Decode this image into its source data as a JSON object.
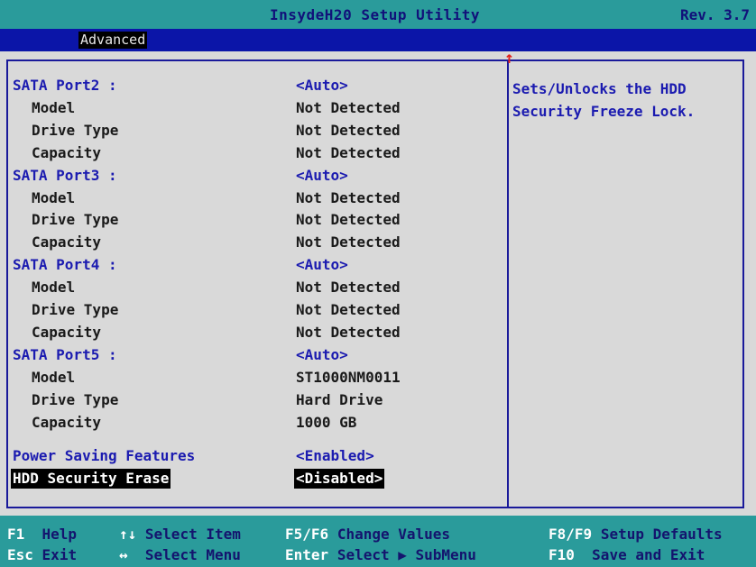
{
  "titlebar": {
    "title": "InsydeH20 Setup Utility",
    "revision": "Rev. 3.7"
  },
  "menu": {
    "active_tab": "Advanced"
  },
  "items": [
    {
      "label": "SATA Port2 :",
      "value": "<Auto>",
      "kind": "header"
    },
    {
      "label": "Model",
      "value": "Not Detected",
      "kind": "sub"
    },
    {
      "label": "Drive Type",
      "value": "Not Detected",
      "kind": "sub"
    },
    {
      "label": "Capacity",
      "value": "Not Detected",
      "kind": "sub"
    },
    {
      "label": "SATA Port3 :",
      "value": "<Auto>",
      "kind": "header"
    },
    {
      "label": "Model",
      "value": "Not Detected",
      "kind": "sub"
    },
    {
      "label": "Drive Type",
      "value": "Not Detected",
      "kind": "sub"
    },
    {
      "label": "Capacity",
      "value": "Not Detected",
      "kind": "sub"
    },
    {
      "label": "SATA Port4 :",
      "value": "<Auto>",
      "kind": "header"
    },
    {
      "label": "Model",
      "value": "Not Detected",
      "kind": "sub"
    },
    {
      "label": "Drive Type",
      "value": "Not Detected",
      "kind": "sub"
    },
    {
      "label": "Capacity",
      "value": "Not Detected",
      "kind": "sub"
    },
    {
      "label": "SATA Port5 :",
      "value": "<Auto>",
      "kind": "header"
    },
    {
      "label": "Model",
      "value": "ST1000NM0011",
      "kind": "sub"
    },
    {
      "label": "Drive Type",
      "value": "Hard Drive",
      "kind": "sub"
    },
    {
      "label": "Capacity",
      "value": "1000 GB",
      "kind": "sub"
    },
    {
      "label": "Power Saving Features",
      "value": "<Enabled>",
      "kind": "header"
    },
    {
      "label": "HDD Security Erase",
      "value": "<Disabled>",
      "kind": "selected"
    }
  ],
  "help": {
    "line1": "Sets/Unlocks the HDD",
    "line2": "Security Freeze Lock."
  },
  "scroll_indicator": "↑",
  "footer": {
    "f1_key": "F1",
    "f1_desc": "Help",
    "select_item_key": "↑↓",
    "select_item_desc": "Select Item",
    "change_key": "F5/F6",
    "change_desc": "Change Values",
    "defaults_key": "F8/F9",
    "defaults_desc": "Setup Defaults",
    "esc_key": "Esc",
    "esc_desc": "Exit",
    "select_menu_key": "↔",
    "select_menu_desc": "Select Menu",
    "enter_key": "Enter",
    "enter_desc": "Select ▶ SubMenu",
    "f10_key": "F10",
    "f10_desc": "Save and Exit"
  },
  "colors": {
    "teal_bar": "#2a9b9b",
    "blue_menu": "#0b15a8",
    "panel_gray": "#d9d9d9",
    "option_blue": "#1b1bb0",
    "footer_key": "#ffffff",
    "footer_desc": "#14146e"
  }
}
